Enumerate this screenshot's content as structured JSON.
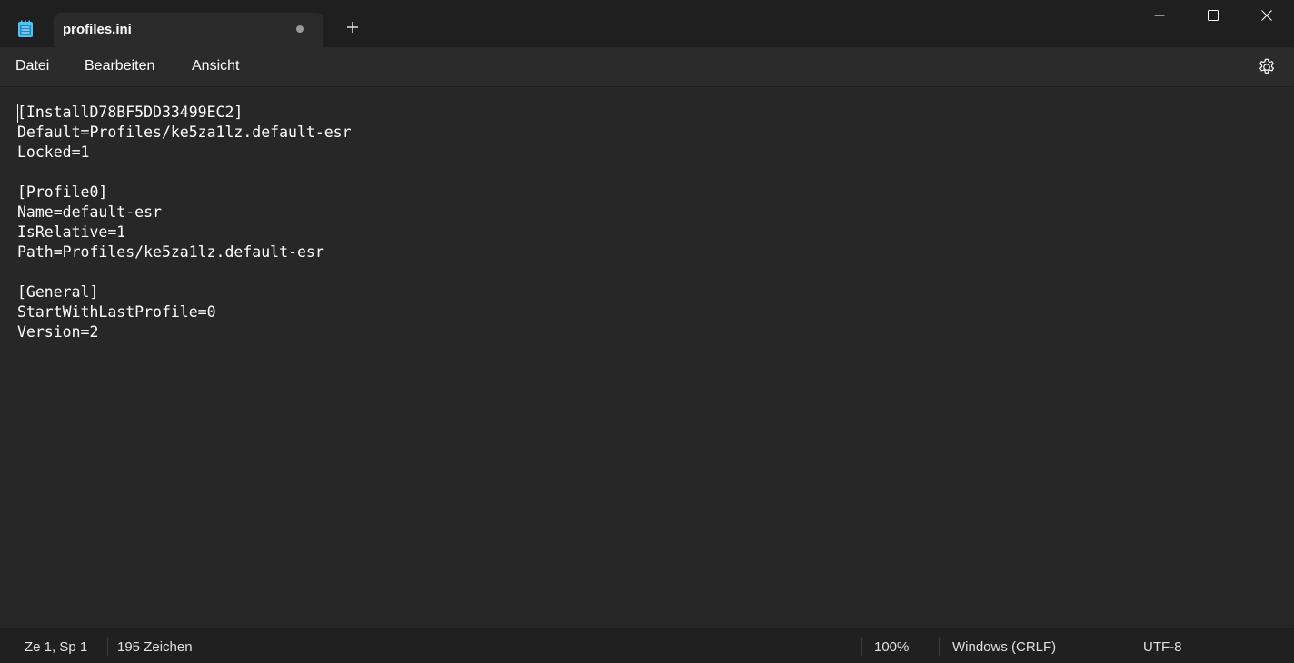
{
  "tab": {
    "title": "profiles.ini",
    "unsaved_indicator": "dot",
    "new_tab_icon": "plus-icon"
  },
  "window_controls": {
    "minimize_icon": "minimize-icon",
    "maximize_icon": "maximize-icon",
    "close_icon": "close-icon"
  },
  "menu": {
    "items": [
      {
        "label": "Datei"
      },
      {
        "label": "Bearbeiten"
      },
      {
        "label": "Ansicht"
      }
    ],
    "settings_icon": "gear-icon"
  },
  "editor": {
    "lines": [
      "[InstallD78BF5DD33499EC2]",
      "Default=Profiles/ke5za1lz.default-esr",
      "Locked=1",
      "",
      "[Profile0]",
      "Name=default-esr",
      "IsRelative=1",
      "Path=Profiles/ke5za1lz.default-esr",
      "",
      "[General]",
      "StartWithLastProfile=0",
      "Version=2"
    ]
  },
  "status": {
    "position": "Ze 1, Sp 1",
    "char_count": "195 Zeichen",
    "zoom": "100%",
    "line_ending": "Windows (CRLF)",
    "encoding": "UTF-8"
  },
  "colors": {
    "titlebar_bg": "#1f1f1f",
    "tab_bg": "#2b2b2b",
    "editor_bg": "#272727",
    "statusbar_bg": "#202020",
    "app_icon_accent": "#4fc3f7"
  }
}
